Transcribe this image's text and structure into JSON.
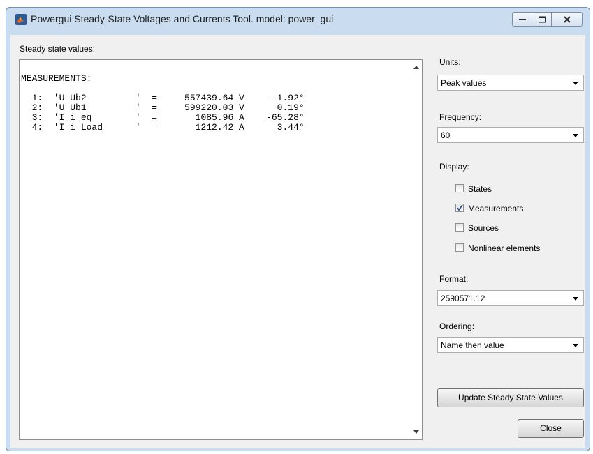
{
  "window": {
    "title": "Powergui Steady-State Voltages and Currents Tool.  model: power_gui"
  },
  "left": {
    "label": "Steady state values:",
    "text": "MEASUREMENTS:\n\n  1:  'U Ub2         '  =     557439.64 V     -1.92°\n  2:  'U Ub1         '  =     599220.03 V      0.19°\n  3:  'I i eq        '  =       1085.96 A    -65.28°\n  4:  'I i Load      '  =       1212.42 A      3.44°"
  },
  "units": {
    "label": "Units:",
    "value": "Peak values"
  },
  "frequency": {
    "label": "Frequency:",
    "value": "60"
  },
  "display": {
    "label": "Display:",
    "states": {
      "label": "States",
      "checked": false
    },
    "measurements": {
      "label": "Measurements",
      "checked": true
    },
    "sources": {
      "label": "Sources",
      "checked": false
    },
    "nonlinear": {
      "label": "Nonlinear elements",
      "checked": false
    }
  },
  "format": {
    "label": "Format:",
    "value": "2590571.12"
  },
  "ordering": {
    "label": "Ordering:",
    "value": "Name then value"
  },
  "buttons": {
    "update": "Update Steady State Values",
    "close": "Close"
  }
}
